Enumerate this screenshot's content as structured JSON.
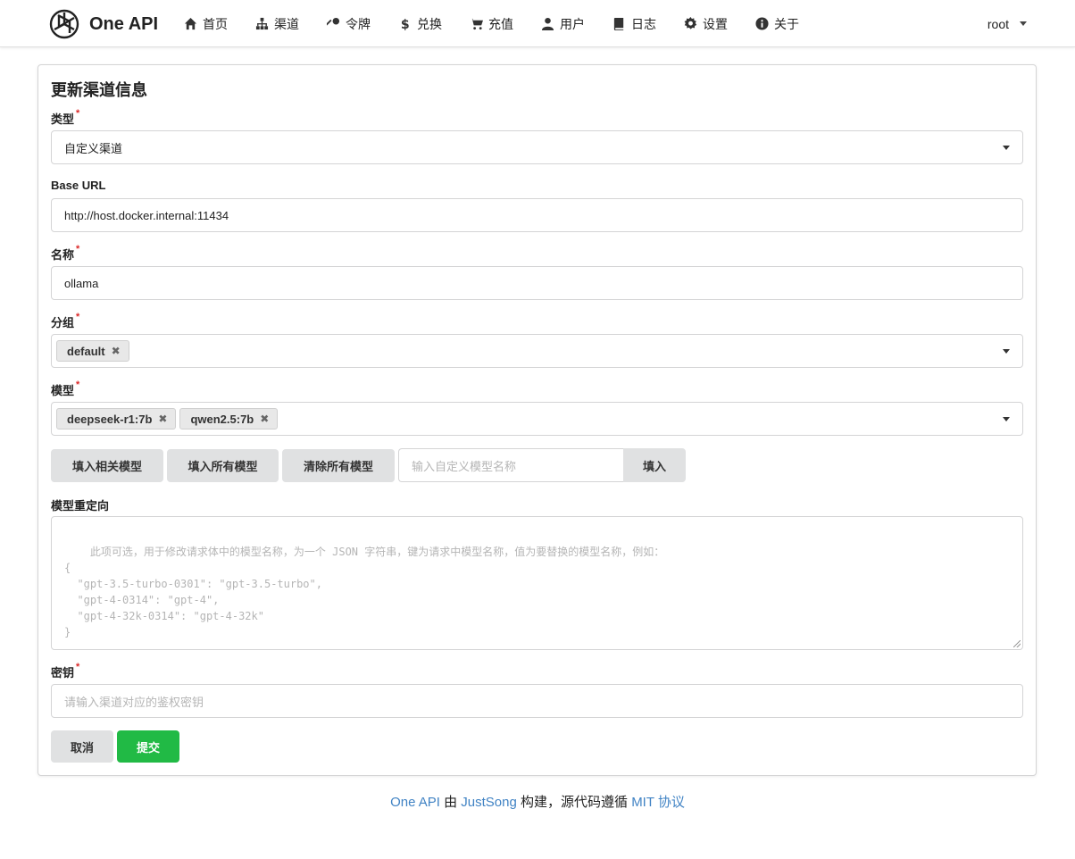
{
  "brand": {
    "name": "One API"
  },
  "nav": [
    {
      "label": "首页",
      "icon": "home-icon"
    },
    {
      "label": "渠道",
      "icon": "sitemap-icon"
    },
    {
      "label": "令牌",
      "icon": "key-icon"
    },
    {
      "label": "兑换",
      "icon": "dollar-icon"
    },
    {
      "label": "充值",
      "icon": "cart-icon"
    },
    {
      "label": "用户",
      "icon": "user-icon"
    },
    {
      "label": "日志",
      "icon": "book-icon"
    },
    {
      "label": "设置",
      "icon": "gear-icon"
    },
    {
      "label": "关于",
      "icon": "info-icon"
    }
  ],
  "user": {
    "name": "root"
  },
  "form": {
    "title": "更新渠道信息",
    "type": {
      "label": "类型",
      "value": "自定义渠道"
    },
    "base_url": {
      "label": "Base URL",
      "value": "http://host.docker.internal:11434"
    },
    "name": {
      "label": "名称",
      "value": "ollama"
    },
    "group": {
      "label": "分组",
      "chips": [
        "default"
      ]
    },
    "models": {
      "label": "模型",
      "chips": [
        "deepseek-r1:7b",
        "qwen2.5:7b"
      ]
    },
    "buttons": {
      "fill_related": "填入相关模型",
      "fill_all": "填入所有模型",
      "clear_all": "清除所有模型",
      "custom_placeholder": "输入自定义模型名称",
      "fill": "填入"
    },
    "mapping": {
      "label": "模型重定向",
      "placeholder": "此项可选，用于修改请求体中的模型名称，为一个 JSON 字符串，键为请求中模型名称，值为要替换的模型名称，例如：\n{\n  \"gpt-3.5-turbo-0301\": \"gpt-3.5-turbo\",\n  \"gpt-4-0314\": \"gpt-4\",\n  \"gpt-4-32k-0314\": \"gpt-4-32k\"\n}"
    },
    "key": {
      "label": "密钥",
      "placeholder": "请输入渠道对应的鉴权密钥"
    },
    "cancel": "取消",
    "submit": "提交"
  },
  "footer": {
    "project": "One API",
    "by": " 由 ",
    "author": "JustSong",
    "built": " 构建，源代码遵循 ",
    "license": "MIT 协议"
  },
  "colors": {
    "primary_green": "#21ba45",
    "link": "#4183c4",
    "required": "#db2828"
  }
}
